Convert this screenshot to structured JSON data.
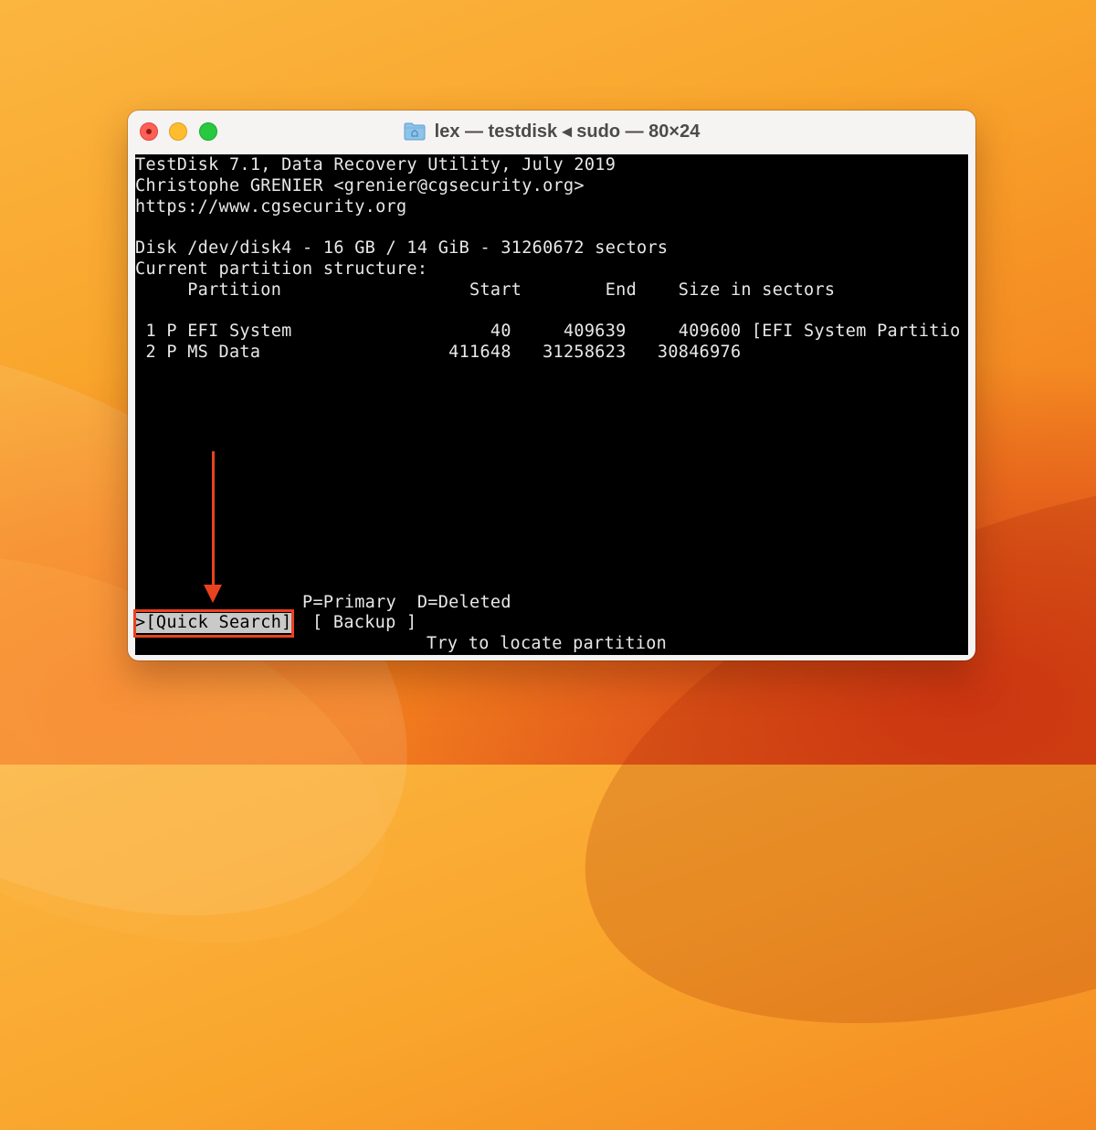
{
  "window": {
    "title": "lex — testdisk ◂ sudo — 80×24"
  },
  "terminal": {
    "header": [
      "TestDisk 7.1, Data Recovery Utility, July 2019",
      "Christophe GRENIER <grenier@cgsecurity.org>",
      "https://www.cgsecurity.org"
    ],
    "disk_info": "Disk /dev/disk4 - 16 GB / 14 GiB - 31260672 sectors",
    "structure_label": "Current partition structure:",
    "columns_line": "     Partition                  Start        End    Size in sectors",
    "partitions": [
      " 1 P EFI System                   40     409639     409600 [EFI System Partitio",
      " 2 P MS Data                  411648   31258623   30846976"
    ],
    "legend": "P=Primary  D=Deleted",
    "menu": {
      "quick_search": ">[Quick Search]",
      "backup": "[ Backup ]"
    },
    "hint": "Try to locate partition"
  },
  "annotation_color": "#e8421e"
}
